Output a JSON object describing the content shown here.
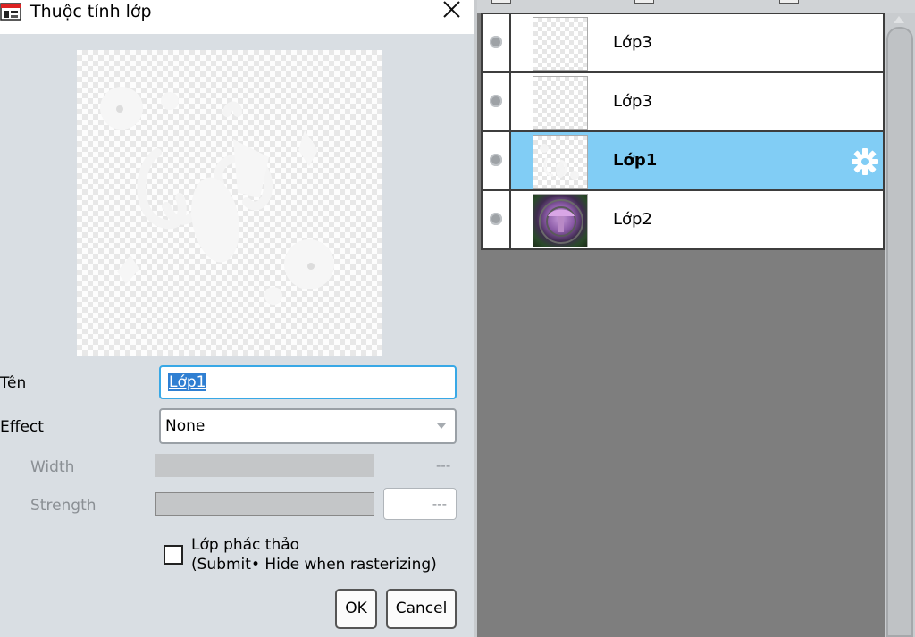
{
  "dialog": {
    "title": "Thuộc tính lớp",
    "fields": {
      "name_label": "Tên",
      "name_value": "Lớp1",
      "effect_label": "Effect",
      "effect_value": "None",
      "width_label": "Width",
      "width_value": "---",
      "strength_label": "Strength",
      "strength_value": "---"
    },
    "draft_checkbox": {
      "checked": false,
      "label_line1": "Lớp phác thảo",
      "label_line2": "(Submit• Hide when rasterizing)"
    },
    "buttons": {
      "ok": "OK",
      "cancel": "Cancel"
    }
  },
  "layers_panel": {
    "layers": [
      {
        "name": "Lớp3",
        "selected": false,
        "thumbnail": "transparent"
      },
      {
        "name": "Lớp3",
        "selected": false,
        "thumbnail": "transparent"
      },
      {
        "name": "Lớp1",
        "selected": true,
        "thumbnail": "sketch"
      },
      {
        "name": "Lớp2",
        "selected": false,
        "thumbnail": "purple-image"
      }
    ],
    "selected_icon": "gear-icon"
  },
  "colors": {
    "selection_blue": "#81cdf5",
    "focus_border": "#38a8e6",
    "text_highlight": "#2f7fd2",
    "panel_background": "#7e7e7e",
    "dialog_background": "#d9dee3"
  }
}
